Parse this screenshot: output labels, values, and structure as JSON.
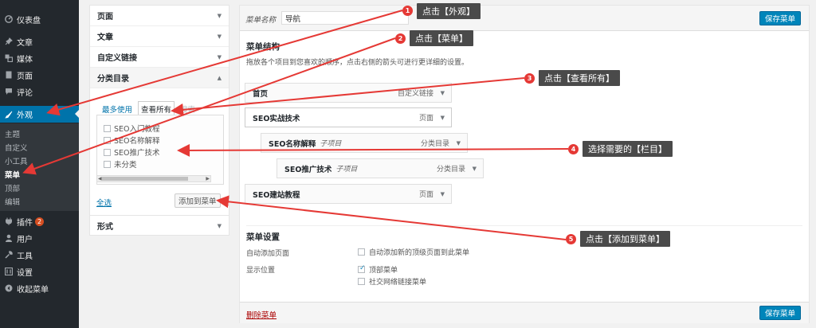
{
  "sidebar": {
    "items": [
      {
        "label": "仪表盘",
        "icon": "dashboard-icon"
      },
      {
        "label": "文章",
        "icon": "pin-icon"
      },
      {
        "label": "媒体",
        "icon": "media-icon"
      },
      {
        "label": "页面",
        "icon": "page-icon"
      },
      {
        "label": "评论",
        "icon": "comment-icon"
      },
      {
        "label": "外观",
        "icon": "brush-icon"
      },
      {
        "label": "插件",
        "icon": "plugin-icon",
        "badge": "2"
      },
      {
        "label": "用户",
        "icon": "user-icon"
      },
      {
        "label": "工具",
        "icon": "wrench-icon"
      },
      {
        "label": "设置",
        "icon": "settings-icon"
      },
      {
        "label": "收起菜单",
        "icon": "collapse-icon"
      }
    ],
    "submenu": [
      "主题",
      "自定义",
      "小工具",
      "菜单",
      "顶部",
      "编辑"
    ]
  },
  "left_panel": {
    "sections": [
      "页面",
      "文章",
      "自定义链接",
      "分类目录"
    ],
    "tabs": [
      "最多使用",
      "查看所有",
      "搜索"
    ],
    "categories": [
      "SEO入门教程",
      "SEO名称解释",
      "SEO推广技术",
      "未分类"
    ],
    "select_all": "全选",
    "add_button": "添加到菜单",
    "format_section": "形式"
  },
  "main": {
    "name_label": "菜单名称",
    "name_value": "导航",
    "save_label": "保存菜单",
    "structure_title": "菜单结构",
    "structure_desc": "拖放各个项目到您喜欢的顺序，点击右侧的箭头可进行更详细的设置。",
    "items": [
      {
        "title": "首页",
        "sub": "",
        "type": "自定义链接"
      },
      {
        "title": "SEO实战技术",
        "sub": "",
        "type": "页面"
      },
      {
        "title": "SEO名称解释",
        "sub": "子项目",
        "type": "分类目录"
      },
      {
        "title": "SEO推广技术",
        "sub": "子项目",
        "type": "分类目录"
      },
      {
        "title": "SEO建站教程",
        "sub": "",
        "type": "页面"
      }
    ],
    "settings_title": "菜单设置",
    "auto_add_label": "自动添加页面",
    "auto_add_option": "自动添加新的顶级页面到此菜单",
    "location_label": "显示位置",
    "location_options": [
      {
        "label": "顶部菜单",
        "checked": true
      },
      {
        "label": "社交网络链接菜单",
        "checked": false
      }
    ],
    "delete_label": "删除菜单"
  },
  "annotations": [
    {
      "num": "1",
      "text": "点击【外观】"
    },
    {
      "num": "2",
      "text": "点击【菜单】"
    },
    {
      "num": "3",
      "text": "点击【查看所有】"
    },
    {
      "num": "4",
      "text": "选择需要的【栏目】"
    },
    {
      "num": "5",
      "text": "点击【添加到菜单】"
    }
  ],
  "colors": {
    "accent": "#0073aa",
    "sidebar": "#23282d",
    "save_button": "#0085ba",
    "annotation_red": "#e53935",
    "callout_bg": "#4a4a4a"
  }
}
